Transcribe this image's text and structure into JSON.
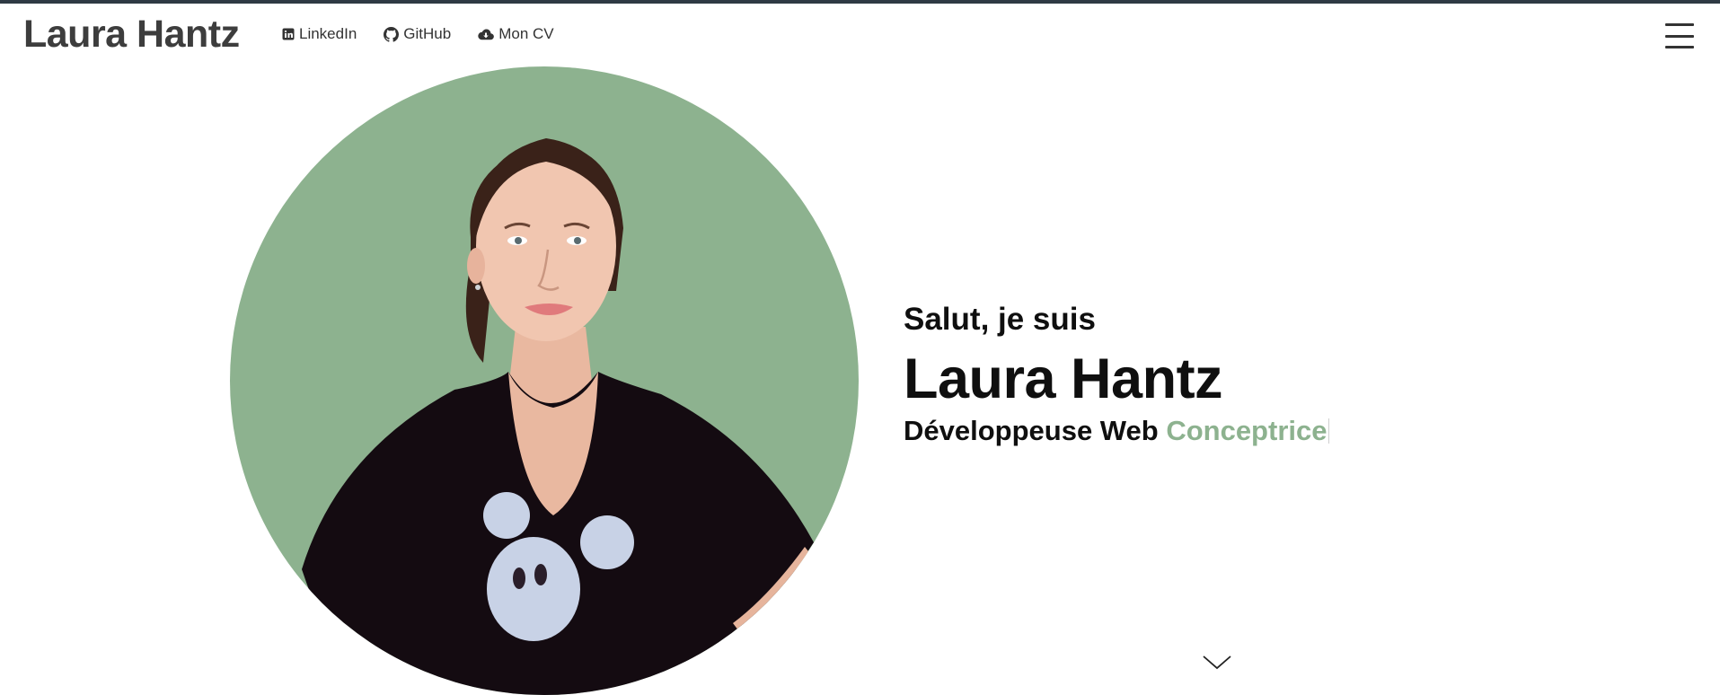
{
  "header": {
    "brand": "Laura Hantz",
    "nav": [
      {
        "label": "LinkedIn",
        "icon": "linkedin-icon"
      },
      {
        "label": "GitHub",
        "icon": "github-icon"
      },
      {
        "label": "Mon CV",
        "icon": "cloud-download-icon"
      }
    ],
    "menu_icon": "hamburger-menu-icon"
  },
  "hero": {
    "greeting": "Salut, je suis",
    "name": "Laura Hantz",
    "role_prefix": "Développeuse Web",
    "role_typed": "Conceptrice",
    "scroll_icon": "chevron-down-icon"
  },
  "colors": {
    "accent": "#8db28f",
    "text": "#0f0f0f",
    "brand": "#3d3d3d",
    "top_border": "#2f3a44"
  }
}
